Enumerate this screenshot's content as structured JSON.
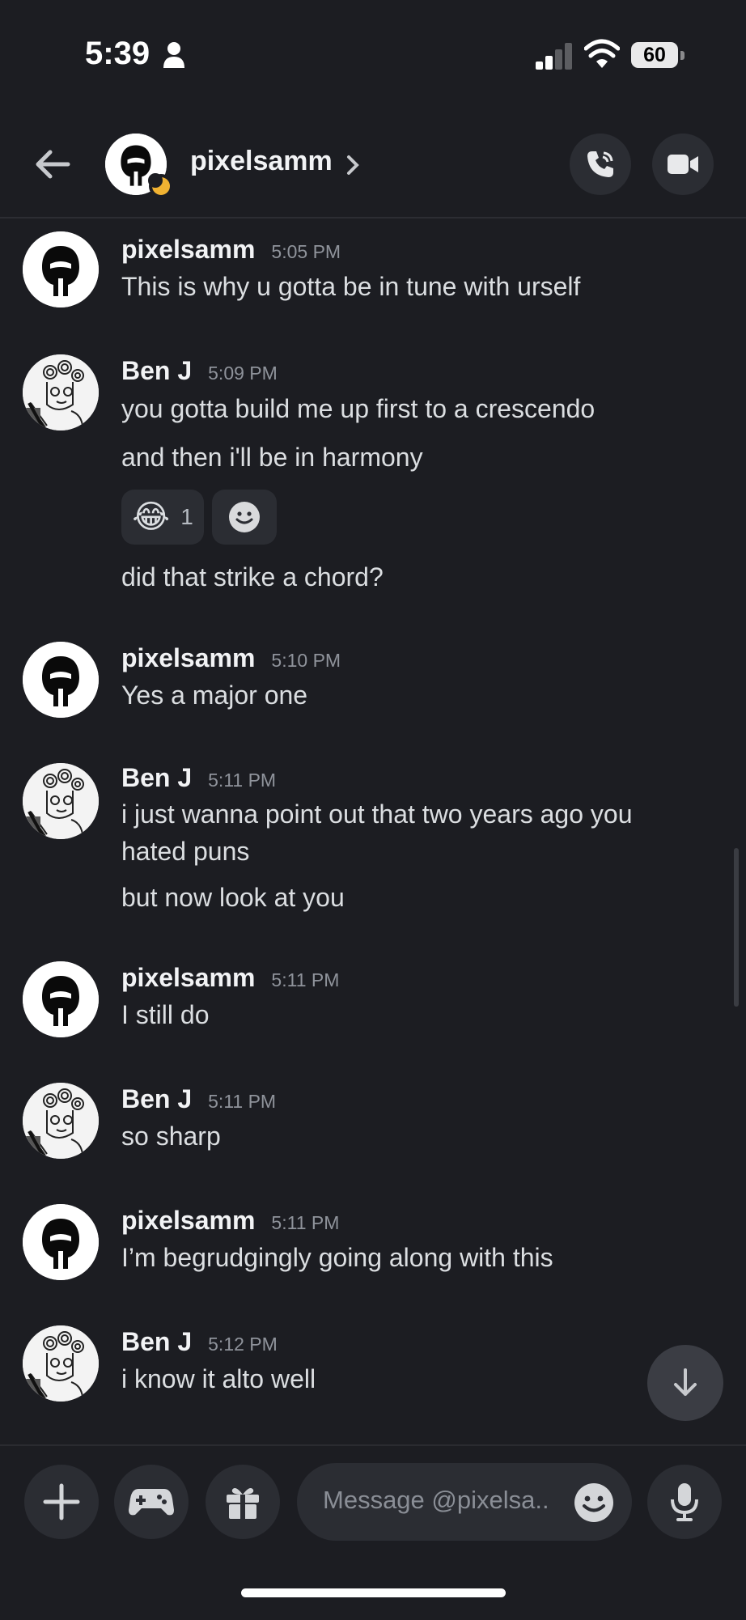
{
  "status_bar": {
    "time": "5:39",
    "battery": "60"
  },
  "header": {
    "username": "pixelsamm"
  },
  "messages": [
    {
      "author": "pixelsamm",
      "time": "5:05 PM",
      "lines": [
        "This is why u gotta be in tune with urself"
      ]
    },
    {
      "author": "Ben J",
      "time": "5:09 PM",
      "lines": [
        "you gotta build me up first to a crescendo",
        "and then i'll be in harmony",
        "did that strike a chord?"
      ]
    },
    {
      "author": "pixelsamm",
      "time": "5:10 PM",
      "lines": [
        "Yes a major one"
      ]
    },
    {
      "author": "Ben J",
      "time": "5:11 PM",
      "lines": [
        "i just wanna point out that two years ago you hated puns",
        "but now look at you"
      ]
    },
    {
      "author": "pixelsamm",
      "time": "5:11 PM",
      "lines": [
        "I still do"
      ]
    },
    {
      "author": "Ben J",
      "time": "5:11 PM",
      "lines": [
        "so sharp"
      ]
    },
    {
      "author": "pixelsamm",
      "time": "5:11 PM",
      "lines": [
        "I’m begrudgingly going along with this"
      ]
    },
    {
      "author": "Ben J",
      "time": "5:12 PM",
      "lines": [
        "i know it alto well"
      ]
    }
  ],
  "reactions": [
    {
      "emoji": "😂",
      "count": "1"
    }
  ],
  "composer": {
    "placeholder": "Message @pixelsa.."
  },
  "icons": {
    "back": "arrow-left-icon",
    "call": "phone-icon",
    "video": "video-camera-icon",
    "add": "plus-icon",
    "games": "gamepad-icon",
    "gift": "gift-icon",
    "emoji": "smiley-icon",
    "mic": "microphone-icon",
    "jump": "arrow-down-icon"
  },
  "colors": {
    "background": "#1c1d22",
    "surface": "#2b2d33",
    "idle_status": "#f0b232",
    "muted_text": "#8f939b"
  }
}
